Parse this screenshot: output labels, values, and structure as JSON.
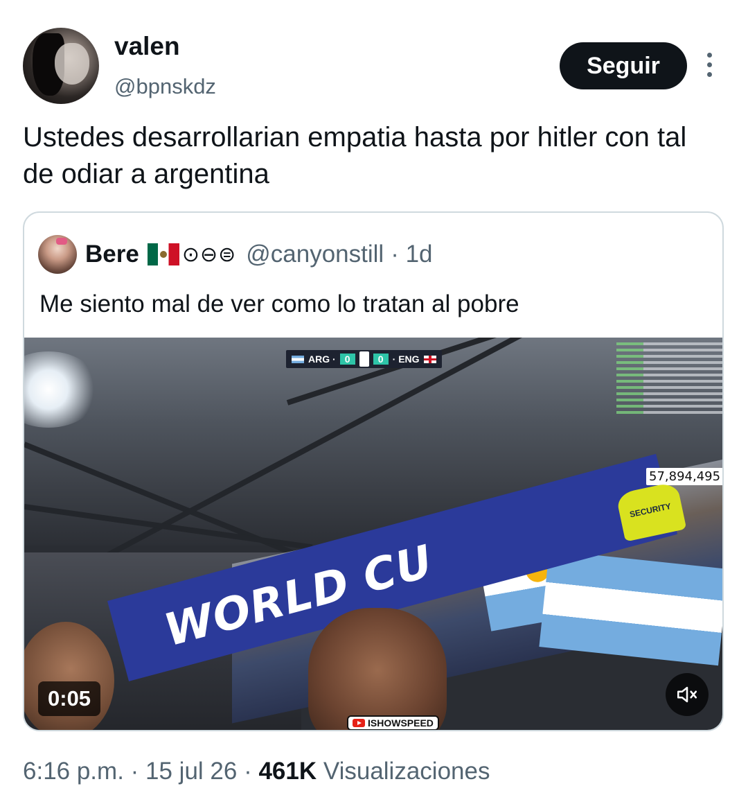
{
  "author": {
    "name": "valen",
    "handle": "@bpnskdz",
    "avatar_icon": "profile-photo"
  },
  "follow_label": "Seguir",
  "more_icon": "more-vertical-icon",
  "tweet_text": "Ustedes desarrollarian empatia hasta por hitler con tal de odiar a argentina",
  "quote": {
    "name": "Bere",
    "flag": "mexico-flag",
    "symbols": "⊙⊖⊜",
    "handle": "@canyonstill",
    "time": "· 1d",
    "text": "Me siento mal de ver como lo tratan al pobre",
    "video": {
      "scoreboard": {
        "team_left": "ARG ·",
        "score_left": "0",
        "score_right": "0",
        "team_right": "· ENG"
      },
      "viewer_count": "57,894,495",
      "security_text": "SECURITY",
      "banner_text": "WORLD CU",
      "watermark": "ISHOWSPEED",
      "time": "0:05",
      "mute_icon": "volume-muted-icon"
    }
  },
  "meta": {
    "time": "6:16 p.m.",
    "sep1": " · ",
    "date": "15 jul 26",
    "sep2": " · ",
    "views_count": "461K",
    "views_label": " Visualizaciones"
  },
  "colors": {
    "text": "#0f1419",
    "secondary": "#536471",
    "border": "#cfd9de",
    "button_bg": "#0f1419"
  }
}
